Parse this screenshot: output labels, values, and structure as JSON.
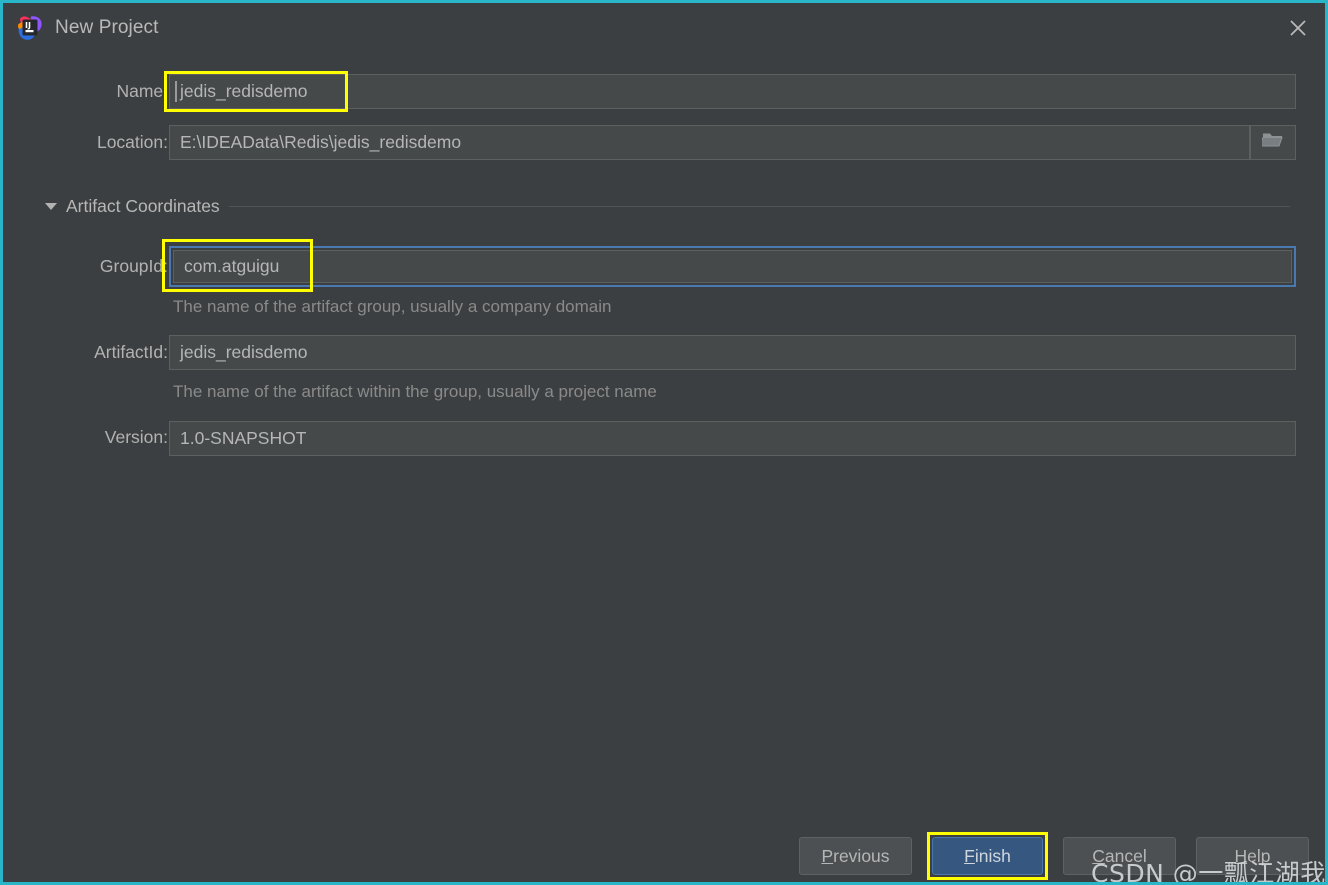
{
  "window": {
    "title": "New Project",
    "app_icon": "intellij-idea-logo",
    "close_icon": "close-icon",
    "border_color": "#29b6c8",
    "background_color": "#3c3f41"
  },
  "form": {
    "name": {
      "label": "Name:",
      "value": "jedis_redisdemo",
      "highlighted": true
    },
    "location": {
      "label": "Location:",
      "value": "E:\\IDEAData\\Redis\\jedis_redisdemo",
      "browse_icon": "folder-icon"
    }
  },
  "artifact_section": {
    "title": "Artifact Coordinates",
    "collapse_icon": "chevron-down-icon",
    "expanded": true,
    "group_id": {
      "label": "GroupId:",
      "value": "com.atguigu",
      "hint": "The name of the artifact group, usually a company domain",
      "focused": true,
      "focus_color": "#4a78b0",
      "highlighted": true
    },
    "artifact_id": {
      "label": "ArtifactId:",
      "value": "jedis_redisdemo",
      "hint": "The name of the artifact within the group, usually a project name"
    },
    "version": {
      "label": "Version:",
      "value": "1.0-SNAPSHOT"
    }
  },
  "footer": {
    "buttons": [
      {
        "label": "Previous",
        "mnemonic": "P",
        "primary": false,
        "highlighted": false
      },
      {
        "label": "Finish",
        "mnemonic": "F",
        "primary": true,
        "highlighted": true
      },
      {
        "label": "Cancel",
        "mnemonic": "C",
        "primary": false,
        "highlighted": false
      },
      {
        "label": "Help",
        "mnemonic": "H",
        "primary": false,
        "highlighted": false
      }
    ]
  },
  "annotation": {
    "color": "#ffff00"
  },
  "watermark": {
    "text": "CSDN @一瓢江湖我沉浮"
  }
}
